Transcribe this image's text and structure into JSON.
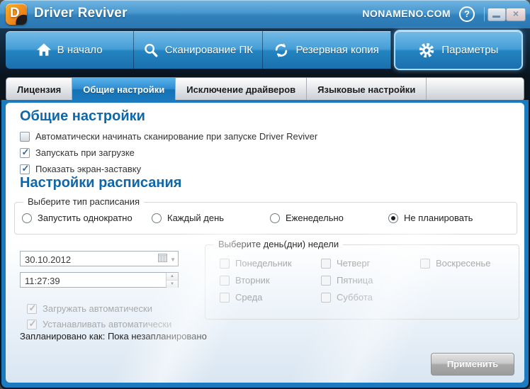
{
  "window": {
    "title": "Driver Reviver",
    "brand": "NONAMENO.COM",
    "logo_letter": "D"
  },
  "icons": {
    "help_glyph": "?",
    "close_glyph": "×",
    "check_glyph": "✓",
    "dropdown_glyph": "▼",
    "spin_up_glyph": "▲",
    "spin_down_glyph": "▼"
  },
  "nav": {
    "items": [
      {
        "label": "В начало",
        "icon": "home-icon",
        "selected": false
      },
      {
        "label": "Сканирование ПК",
        "icon": "search-icon",
        "selected": false
      },
      {
        "label": "Резервная копия",
        "icon": "refresh-icon",
        "selected": false
      },
      {
        "label": "Параметры",
        "icon": "gear-icon",
        "selected": true
      }
    ]
  },
  "tabs": [
    {
      "label": "Лицензия",
      "active": false
    },
    {
      "label": "Общие настройки",
      "active": true
    },
    {
      "label": "Исключение драйверов",
      "active": false
    },
    {
      "label": "Языковые настройки",
      "active": false
    }
  ],
  "general": {
    "heading": "Общие настройки",
    "checkboxes": [
      {
        "label": "Автоматически начинать сканирование при запуске Driver Reviver",
        "checked": false,
        "disabled": false
      },
      {
        "label": "Запускать при загрузке",
        "checked": true,
        "disabled": false
      },
      {
        "label": "Показать экран-заставку",
        "checked": true,
        "disabled": false
      }
    ]
  },
  "schedule": {
    "heading": "Настройки расписания",
    "type_group": {
      "label": "Выберите тип расписания",
      "options": [
        {
          "label": "Запустить однократно",
          "selected": false
        },
        {
          "label": "Каждый день",
          "selected": false
        },
        {
          "label": "Еженедельно",
          "selected": false
        },
        {
          "label": "Не планировать",
          "selected": true
        }
      ]
    },
    "date_value": "30.10.2012",
    "time_value": "11:27:39",
    "auto_checkboxes": [
      {
        "label": "Загружать автоматически",
        "checked": true,
        "disabled": true
      },
      {
        "label": "Устанавливать автоматически",
        "checked": true,
        "disabled": true
      }
    ],
    "days_group": {
      "label": "Выберите день(дни) недели",
      "columns": [
        [
          "Понедельник",
          "Вторник",
          "Среда"
        ],
        [
          "Четверг",
          "Пятница",
          "Суббота"
        ],
        [
          "Воскресенье"
        ]
      ]
    },
    "status": "Запланировано как: Пока незапланировано",
    "apply_label": "Применить"
  },
  "colors": {
    "accent_blue": "#1c7ac0",
    "heading_blue": "#0e67a8",
    "titlebar_top": "#6fb5e2",
    "tab_active": "#2e8dd2",
    "logo_orange": "#f08a1d",
    "disabled_text": "#a9a9a9"
  }
}
